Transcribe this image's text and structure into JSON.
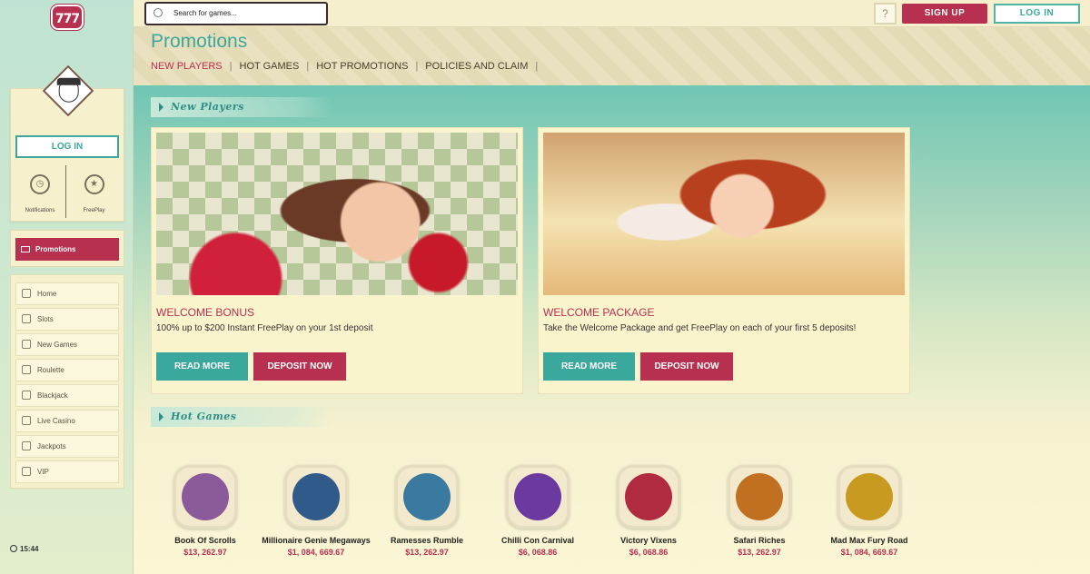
{
  "brand": {
    "logo_text": "777"
  },
  "search": {
    "placeholder": "Search for games..."
  },
  "topbar": {
    "help_label": "?",
    "signup_label": "SIGN UP",
    "login_label": "LOG IN"
  },
  "sidebar": {
    "login_label": "LOG IN",
    "quick": [
      {
        "label": "Notifications",
        "icon": "alarm-clock-icon"
      },
      {
        "label": "FreePlay",
        "icon": "freeplay-badge-icon"
      }
    ],
    "promotions_label": "Promotions",
    "nav": [
      {
        "label": "Home",
        "icon": "home-icon"
      },
      {
        "label": "Slots",
        "icon": "cocktail-icon"
      },
      {
        "label": "New Games",
        "icon": "new-icon"
      },
      {
        "label": "Roulette",
        "icon": "roulette-icon"
      },
      {
        "label": "Blackjack",
        "icon": "cards-icon"
      },
      {
        "label": "Live Casino",
        "icon": "live-icon"
      },
      {
        "label": "Jackpots",
        "icon": "crown-icon"
      },
      {
        "label": "VIP",
        "icon": "diamond-icon"
      }
    ],
    "clock": "15:44"
  },
  "page": {
    "title": "Promotions",
    "tabs": [
      "NEW PLAYERS",
      "HOT GAMES",
      "HOT PROMOTIONS",
      "POLICIES AND CLAIM"
    ],
    "active_tab": "NEW PLAYERS"
  },
  "sections": {
    "new_players": "New Players",
    "hot_games": "Hot Games"
  },
  "promos": [
    {
      "title": "WELCOME BONUS",
      "desc": "100% up to $200 Instant FreePlay on your 1st deposit",
      "read_more": "READ MORE",
      "deposit": "DEPOSIT NOW"
    },
    {
      "title": "WELCOME PACKAGE",
      "desc": "Take the Welcome Package and get FreePlay on each of your first 5 deposits!",
      "read_more": "READ MORE",
      "deposit": "DEPOSIT NOW"
    }
  ],
  "games": [
    {
      "name": "Book Of Scrolls",
      "jackpot": "$13, 262.97",
      "color": "#8a5a9a"
    },
    {
      "name": "Millionaire Genie Megaways",
      "jackpot": "$1, 084, 669.67",
      "color": "#2f5a8a"
    },
    {
      "name": "Ramesses Rumble",
      "jackpot": "$13, 262.97",
      "color": "#3a7aa0"
    },
    {
      "name": "Chilli Con Carnival",
      "jackpot": "$6, 068.86",
      "color": "#6a3aa0"
    },
    {
      "name": "Victory Vixens",
      "jackpot": "$6, 068.86",
      "color": "#b02a40"
    },
    {
      "name": "Safari Riches",
      "jackpot": "$13, 262.97",
      "color": "#c07020"
    },
    {
      "name": "Mad Max Fury Road",
      "jackpot": "$1, 084, 669.67",
      "color": "#c89a20"
    }
  ],
  "colors": {
    "brand_red": "#b8304f",
    "teal": "#3aa89d",
    "cream": "#fbf6d4"
  }
}
